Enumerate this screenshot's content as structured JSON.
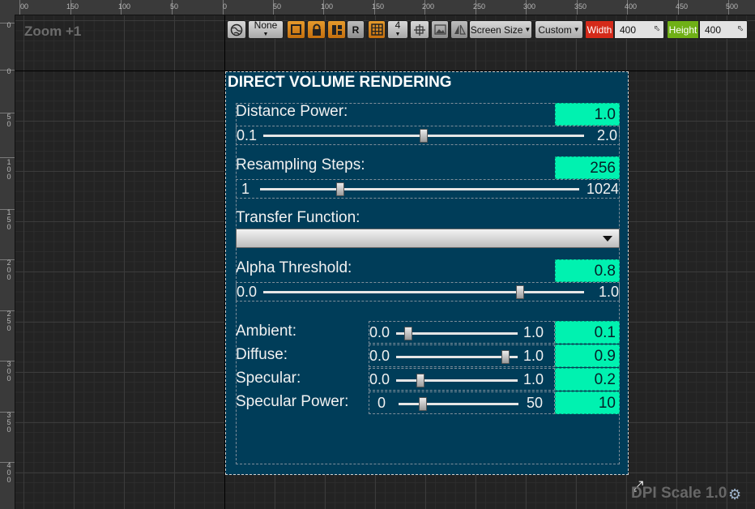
{
  "ruler": {
    "top_labels": [
      "00",
      "150",
      "100",
      "50",
      "0",
      "50",
      "100",
      "150",
      "200",
      "250",
      "300",
      "350",
      "400",
      "450",
      "500"
    ],
    "left_labels": [
      "0",
      "0",
      "50",
      "100",
      "150",
      "200",
      "250",
      "300",
      "350",
      "400"
    ]
  },
  "zoom_label": "Zoom +1",
  "toolbar": {
    "globe_icon": "globe-icon",
    "localization_value": "None",
    "r_label": "R",
    "grid_snap_value": "4",
    "screen_size_label": "Screen Size",
    "custom_label": "Custom",
    "width_label": "Width",
    "width_value": "400",
    "height_label": "Height",
    "height_value": "400"
  },
  "panel": {
    "title": "DIRECT VOLUME RENDERING",
    "distance_power": {
      "label": "Distance Power:",
      "value": "1.0",
      "min": "0.1",
      "max": "2.0",
      "fraction": 0.5
    },
    "resampling_steps": {
      "label": "Resampling Steps:",
      "value": "256",
      "min": "1",
      "max": "1024",
      "fraction": 0.25
    },
    "transfer_function": {
      "label": "Transfer Function:",
      "selected": ""
    },
    "alpha_threshold": {
      "label": "Alpha Threshold:",
      "value": "0.8",
      "min": "0.0",
      "max": "1.0",
      "fraction": 0.8
    },
    "ambient": {
      "label": "Ambient:",
      "min": "0.0",
      "max": "1.0",
      "value": "0.1",
      "fraction": 0.1
    },
    "diffuse": {
      "label": "Diffuse:",
      "min": "0.0",
      "max": "1.0",
      "value": "0.9",
      "fraction": 0.9
    },
    "specular": {
      "label": "Specular:",
      "min": "0.0",
      "max": "1.0",
      "value": "0.2",
      "fraction": 0.2
    },
    "specular_power": {
      "label": "Specular Power:",
      "min": "0",
      "max": "50",
      "value": "10",
      "fraction": 0.2
    }
  },
  "dpi_label": "DPI Scale 1.0",
  "colors": {
    "panel_bg": "#003d59",
    "value_box": "#00f2b0",
    "width_tag": "#d42a1a",
    "height_tag": "#6fb016",
    "orange_button": "#e59a2c"
  }
}
